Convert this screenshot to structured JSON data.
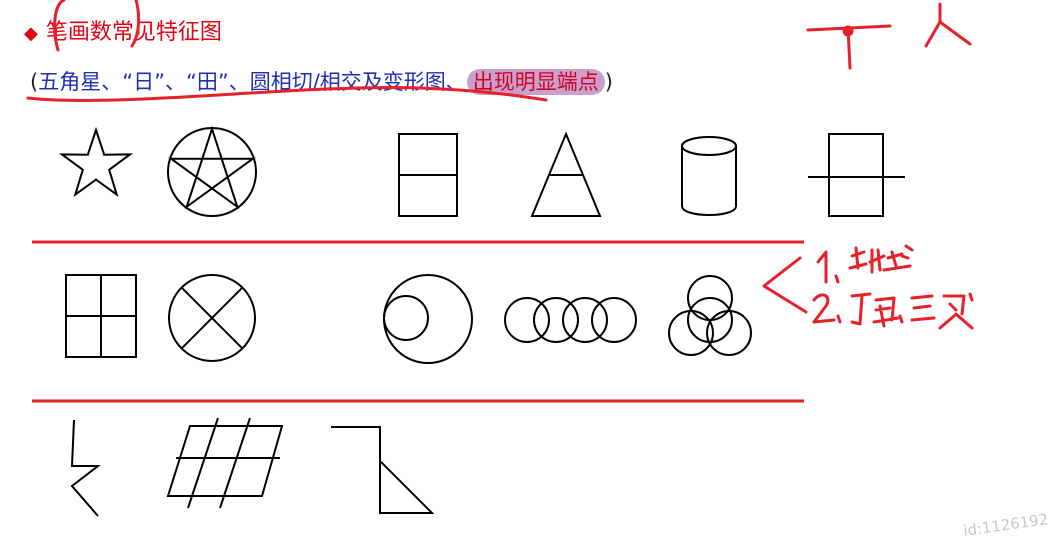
{
  "title": {
    "marker": "◆",
    "text": "笔画数常见特征图"
  },
  "subtitle": {
    "open_paren": "(",
    "text": "五角星、“日”、“田”、圆相切/相交及变形图、",
    "highlight": "出现明显端点",
    "close_paren": ")"
  },
  "watermark": "id:1126192",
  "colors": {
    "accent": "#e60012",
    "subtitle_text": "#1f2fb5",
    "highlight_bg": "#c9a0cc",
    "annotation_ink": "#e8202a",
    "figure_stroke": "#000000"
  }
}
